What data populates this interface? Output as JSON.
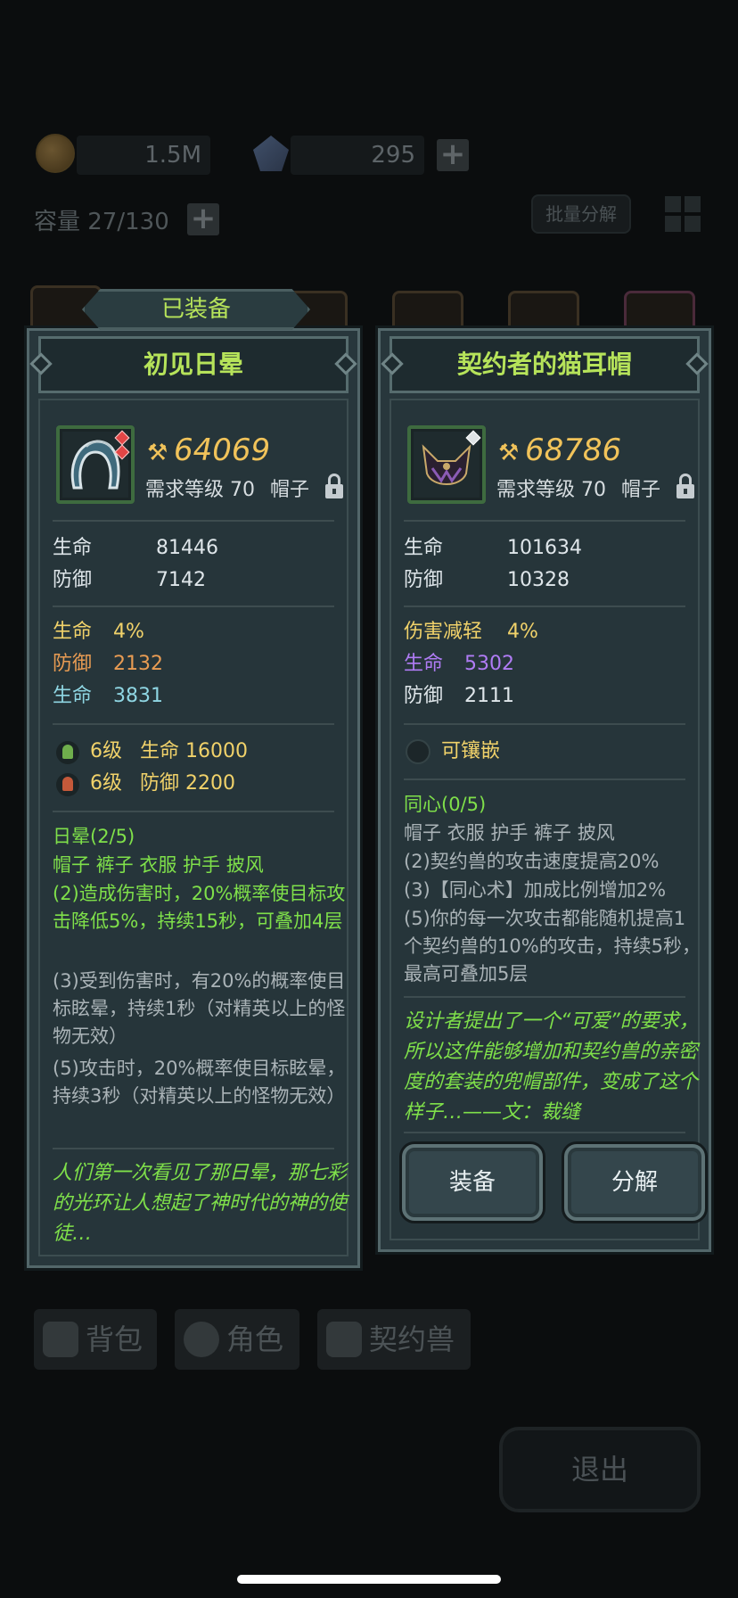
{
  "background": {
    "gold_amount": "1.5M",
    "crystal_amount": "295",
    "capacity_label": "容量 27/130",
    "batch_decompose_label": "批量分解",
    "tabs": [
      "背包",
      "角色",
      "契约兽"
    ],
    "exit_label": "退出"
  },
  "equipped_banner": "已装备",
  "left_item": {
    "name": "初见日晕",
    "power": "64069",
    "required_level": "需求等级 70",
    "slot": "帽子",
    "base_stats": [
      {
        "name": "生命",
        "value": "81446"
      },
      {
        "name": "防御",
        "value": "7142"
      }
    ],
    "extra_stats": [
      {
        "name": "生命",
        "value": "4%",
        "color": "#f1d26a"
      },
      {
        "name": "防御",
        "value": "2132",
        "color": "#e99c53"
      },
      {
        "name": "生命",
        "value": "3831",
        "color": "#8fd6e3"
      }
    ],
    "gem_stats": [
      {
        "level": "6级",
        "stat": "生命 16000"
      },
      {
        "level": "6级",
        "stat": "防御 2200"
      }
    ],
    "set_name": "日晕(2/5)",
    "set_pieces": "帽子 裤子 衣服 护手 披风",
    "set_bonus_active": "(2)造成伤害时，20%概率使目标攻击降低5%，持续15秒，可叠加4层",
    "set_bonus_3": "(3)受到伤害时，有20%的概率使目标眩晕，持续1秒（对精英以上的怪物无效）",
    "set_bonus_5": "(5)攻击时，20%概率使目标眩晕，持续3秒（对精英以上的怪物无效）",
    "flavor": "人们第一次看见了那日晕，那七彩的光环让人想起了神时代的神的使徒…"
  },
  "right_item": {
    "name": "契约者的猫耳帽",
    "power": "68786",
    "required_level": "需求等级 70",
    "slot": "帽子",
    "base_stats": [
      {
        "name": "生命",
        "value": "101634"
      },
      {
        "name": "防御",
        "value": "10328"
      }
    ],
    "extra_stats": [
      {
        "name": "伤害减轻",
        "value": "4%",
        "color": "#f1d26a"
      },
      {
        "name": "生命",
        "value": "5302",
        "color": "#b07cf5"
      },
      {
        "name": "防御",
        "value": "2111",
        "color": "#dfe6ea"
      }
    ],
    "socket_label": "可镶嵌",
    "set_name": "同心(0/5)",
    "set_pieces": "帽子 衣服 护手 裤子 披风",
    "set_bonus_2": "(2)契约兽的攻击速度提高20%",
    "set_bonus_3": "(3)【同心术】加成比例增加2%",
    "set_bonus_5": "(5)你的每一次攻击都能随机提高1个契约兽的10%的攻击，持续5秒，最高可叠加5层",
    "flavor": "设计者提出了一个“可爱”的要求，所以这件能够增加和契约兽的亲密度的套装的兜帽部件，变成了这个样子…——文：裁缝",
    "equip_label": "装备",
    "decompose_label": "分解"
  }
}
